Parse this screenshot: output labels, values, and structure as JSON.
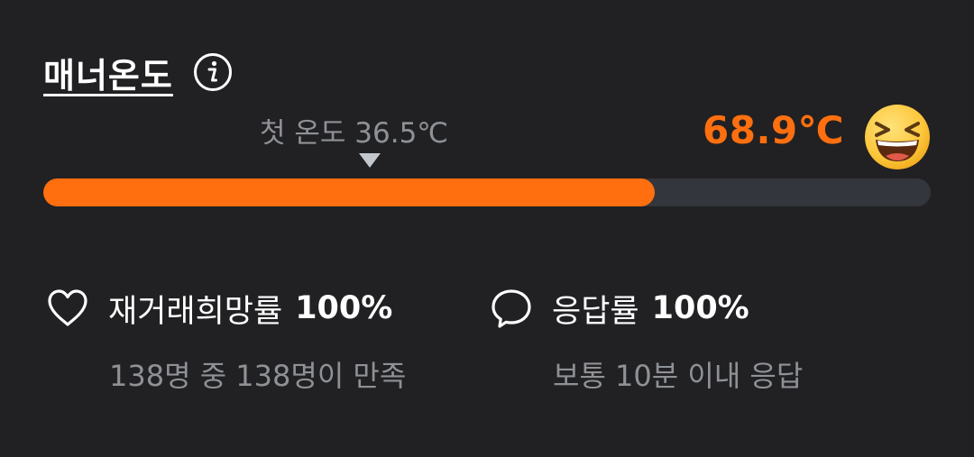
{
  "manner": {
    "title": "매너온도",
    "info_icon": "info-circle-icon",
    "first_temp_label": "첫 온도 36.5℃",
    "first_temp_value": 36.5,
    "current_temp_label": "68.9℃",
    "current_temp_value": 68.9,
    "progress_percent": 68.9,
    "face_icon": "laughing-face-icon",
    "accent_color": "#ff6f0f",
    "track_color": "#33363c"
  },
  "stats": {
    "rebuy": {
      "icon": "heart-icon",
      "label": "재거래희망률",
      "value": "100%",
      "sub": "138명 중 138명이 만족"
    },
    "response": {
      "icon": "chat-bubble-icon",
      "label": "응답률",
      "value": "100%",
      "sub": "보통 10분 이내 응답"
    }
  }
}
